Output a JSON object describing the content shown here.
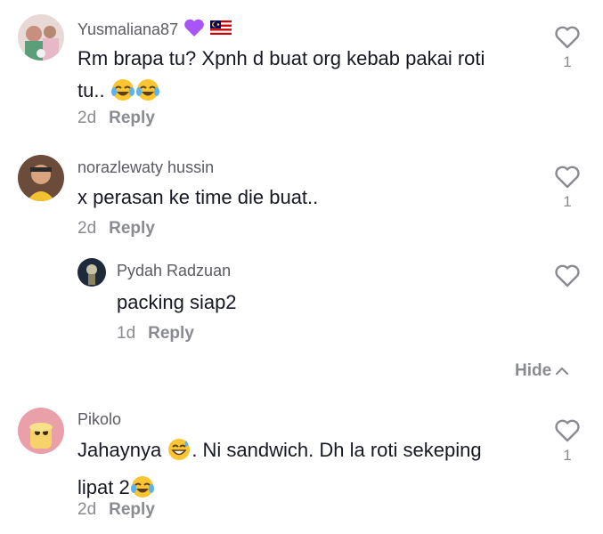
{
  "comments": [
    {
      "username": "Yusmaliana87",
      "badges": [
        "purple-heart-icon",
        "malaysia-flag-icon"
      ],
      "text_line1": "Rm brapa tu? Xpnh d buat org kebab pakai roti",
      "text_line2": "tu..",
      "emojis_after_line2": [
        "face-with-tears-of-joy-icon",
        "face-with-tears-of-joy-icon"
      ],
      "time": "2d",
      "reply_label": "Reply",
      "likes": "1"
    },
    {
      "username": "norazlewaty hussin",
      "text_line1": "x perasan ke time die buat..",
      "time": "2d",
      "reply_label": "Reply",
      "likes": "1",
      "replies": [
        {
          "username": "Pydah Radzuan",
          "text_line1": "packing siap2",
          "time": "1d",
          "reply_label": "Reply",
          "likes": ""
        }
      ]
    },
    {
      "username": "Pikolo",
      "text_line1_a": "Jahaynya",
      "text_line1_emoji": "grinning-face-with-sweat-icon",
      "text_line1_b": ". Ni sandwich. Dh la roti sekeping",
      "text_line2": "lipat 2",
      "emojis_after_line2": [
        "face-with-tears-of-joy-icon"
      ],
      "time": "2d",
      "reply_label": "Reply",
      "likes": "1"
    }
  ],
  "hide_label": "Hide",
  "colors": {
    "text": "#161823",
    "secondary": "#8a8b91",
    "username": "#5b5c63",
    "heart_badge": "#a855f7"
  }
}
